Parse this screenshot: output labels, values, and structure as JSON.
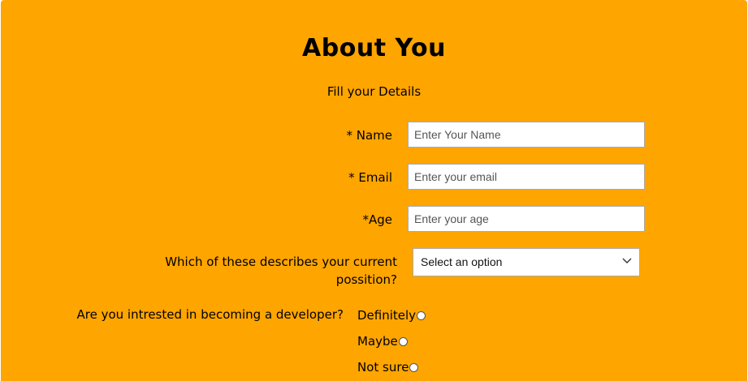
{
  "form": {
    "title": "About You",
    "subtitle": "Fill your Details",
    "name": {
      "label": "* Name",
      "placeholder": "Enter Your Name"
    },
    "email": {
      "label": "* Email",
      "placeholder": "Enter your email"
    },
    "age": {
      "label": "*Age",
      "placeholder": "Enter your age"
    },
    "position": {
      "label_line1": "Which of these describes your current",
      "label_line2": "possition?",
      "selected": "Select an option"
    },
    "developer": {
      "label": "Are you intrested in becoming a developer?",
      "options": [
        "Definitely",
        "Maybe",
        "Not sure"
      ]
    }
  },
  "colors": {
    "background": "#ffa500",
    "input_bg": "#ffffff"
  },
  "icons": {
    "select_arrow": "chevron-down-icon"
  }
}
